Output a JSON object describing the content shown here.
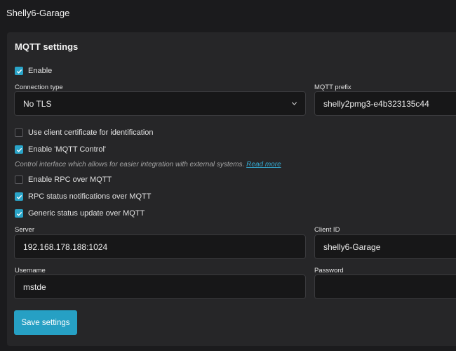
{
  "header": {
    "device_name": "Shelly6-Garage"
  },
  "mqtt": {
    "title": "MQTT settings",
    "enable": {
      "label": "Enable",
      "checked": true
    },
    "connection_type": {
      "label": "Connection type",
      "value": "No TLS"
    },
    "prefix": {
      "label": "MQTT prefix",
      "value": "shelly2pmg3-e4b323135c44"
    },
    "use_client_cert": {
      "label": "Use client certificate for identification",
      "checked": false
    },
    "enable_mqtt_control": {
      "label": "Enable 'MQTT Control'",
      "checked": true
    },
    "control_hint": {
      "text": "Control interface which allows for easier integration with external systems.",
      "link": "Read more"
    },
    "enable_rpc": {
      "label": "Enable RPC over MQTT",
      "checked": false
    },
    "rpc_status": {
      "label": "RPC status notifications over MQTT",
      "checked": true
    },
    "generic_status": {
      "label": "Generic status update over MQTT",
      "checked": true
    },
    "server": {
      "label": "Server",
      "value": "192.168.178.188:1024"
    },
    "client_id": {
      "label": "Client ID",
      "value": "shelly6-Garage"
    },
    "username": {
      "label": "Username",
      "value": "mstde"
    },
    "password": {
      "label": "Password",
      "value": ""
    },
    "save_label": "Save settings"
  },
  "colors": {
    "accent": "#2aa4c8",
    "background": "#1b1b1d",
    "card": "#262628",
    "input": "#171718"
  },
  "icons": {
    "checkbox_checked": "check-icon",
    "select_chevron": "chevron-down-icon"
  }
}
